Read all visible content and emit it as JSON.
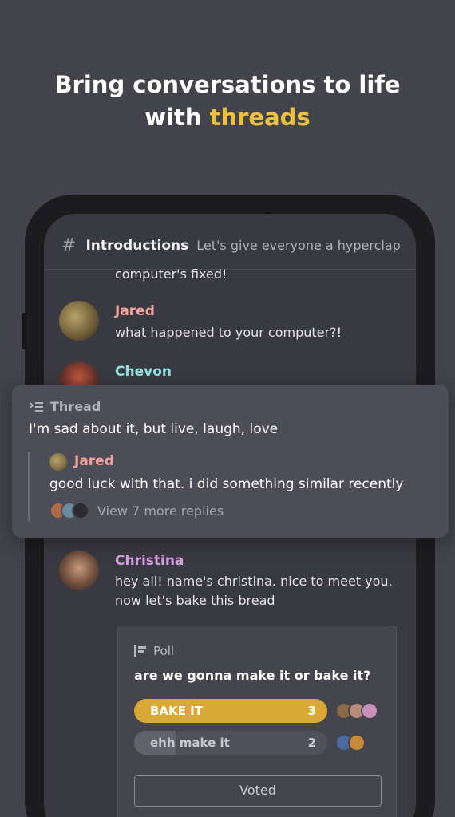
{
  "headline": {
    "line1": "Bring conversations to life",
    "line2_prefix": "with ",
    "line2_highlight": "threads"
  },
  "channel": {
    "name": "Introductions",
    "topic": "Let's give everyone a hyperclap"
  },
  "messages": [
    {
      "partial_text": "computer's fixed!"
    },
    {
      "user": "Jared",
      "text": "what happened to your computer?!",
      "color": "#f2a39b"
    },
    {
      "user": "Chevon",
      "color": "#8fe3e1"
    },
    {
      "user": "Christina",
      "text_line1": "hey all! name's christina. nice to meet you.",
      "text_line2": "now let's bake this bread",
      "color": "#d39fe0"
    }
  ],
  "thread": {
    "label": "Thread",
    "text": "I'm sad about it, but live, laugh, love",
    "reply_user": "Jared",
    "reply_text": "good luck with that. i did something similar recently",
    "more_replies": "View 7 more replies"
  },
  "poll": {
    "label": "Poll",
    "question": "are we gonna make it or bake it?",
    "options": [
      {
        "label": "BAKE IT",
        "count": "3"
      },
      {
        "label": "ehh make it",
        "count": "2"
      }
    ],
    "voted_label": "Voted"
  },
  "colors": {
    "accent": "#f0bf3c",
    "poll_bar": "#d9a835"
  }
}
